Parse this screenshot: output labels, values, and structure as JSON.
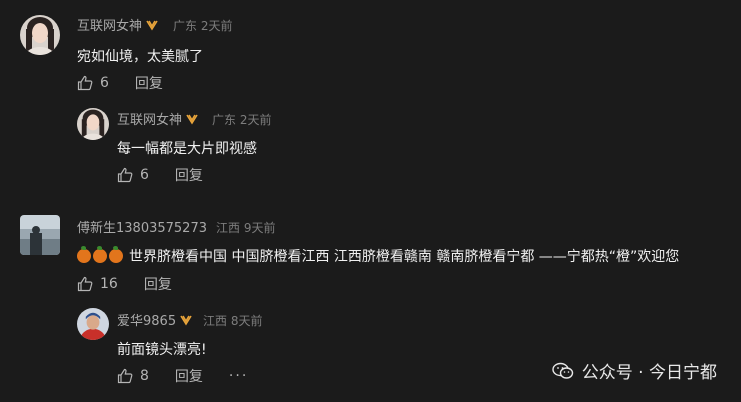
{
  "comments": [
    {
      "user": "互联网女神",
      "location": "广东",
      "time": "2天前",
      "text": "宛如仙境，太美腻了",
      "likes": "6",
      "reply_label": "回复",
      "avatar_icon": "woman-portrait-avatar"
    },
    {
      "user": "互联网女神",
      "location": "广东",
      "time": "2天前",
      "text": "每一幅都是大片即视感",
      "likes": "6",
      "reply_label": "回复",
      "avatar_icon": "woman-portrait-avatar"
    },
    {
      "user": "傅新生13803575273",
      "location": "江西",
      "time": "9天前",
      "text": "世界脐橙看中国 中国脐橙看江西 江西脐橙看赣南 赣南脐橙看宁都 ——宁都热“橙”欢迎您",
      "likes": "16",
      "reply_label": "回复",
      "avatar_icon": "lake-scene-avatar"
    },
    {
      "user": "爱华9865",
      "location": "江西",
      "time": "8天前",
      "text": "前面镜头漂亮!",
      "likes": "8",
      "reply_label": "回复",
      "more_label": "···",
      "avatar_icon": "man-red-shirt-avatar"
    }
  ],
  "watermark": {
    "text": "公众号 · 今日宁都",
    "icon": "wechat-icon"
  },
  "colors": {
    "background": "#1b1b1b",
    "badge": "#e8a43a",
    "orange_emoji": "#e2751c"
  }
}
